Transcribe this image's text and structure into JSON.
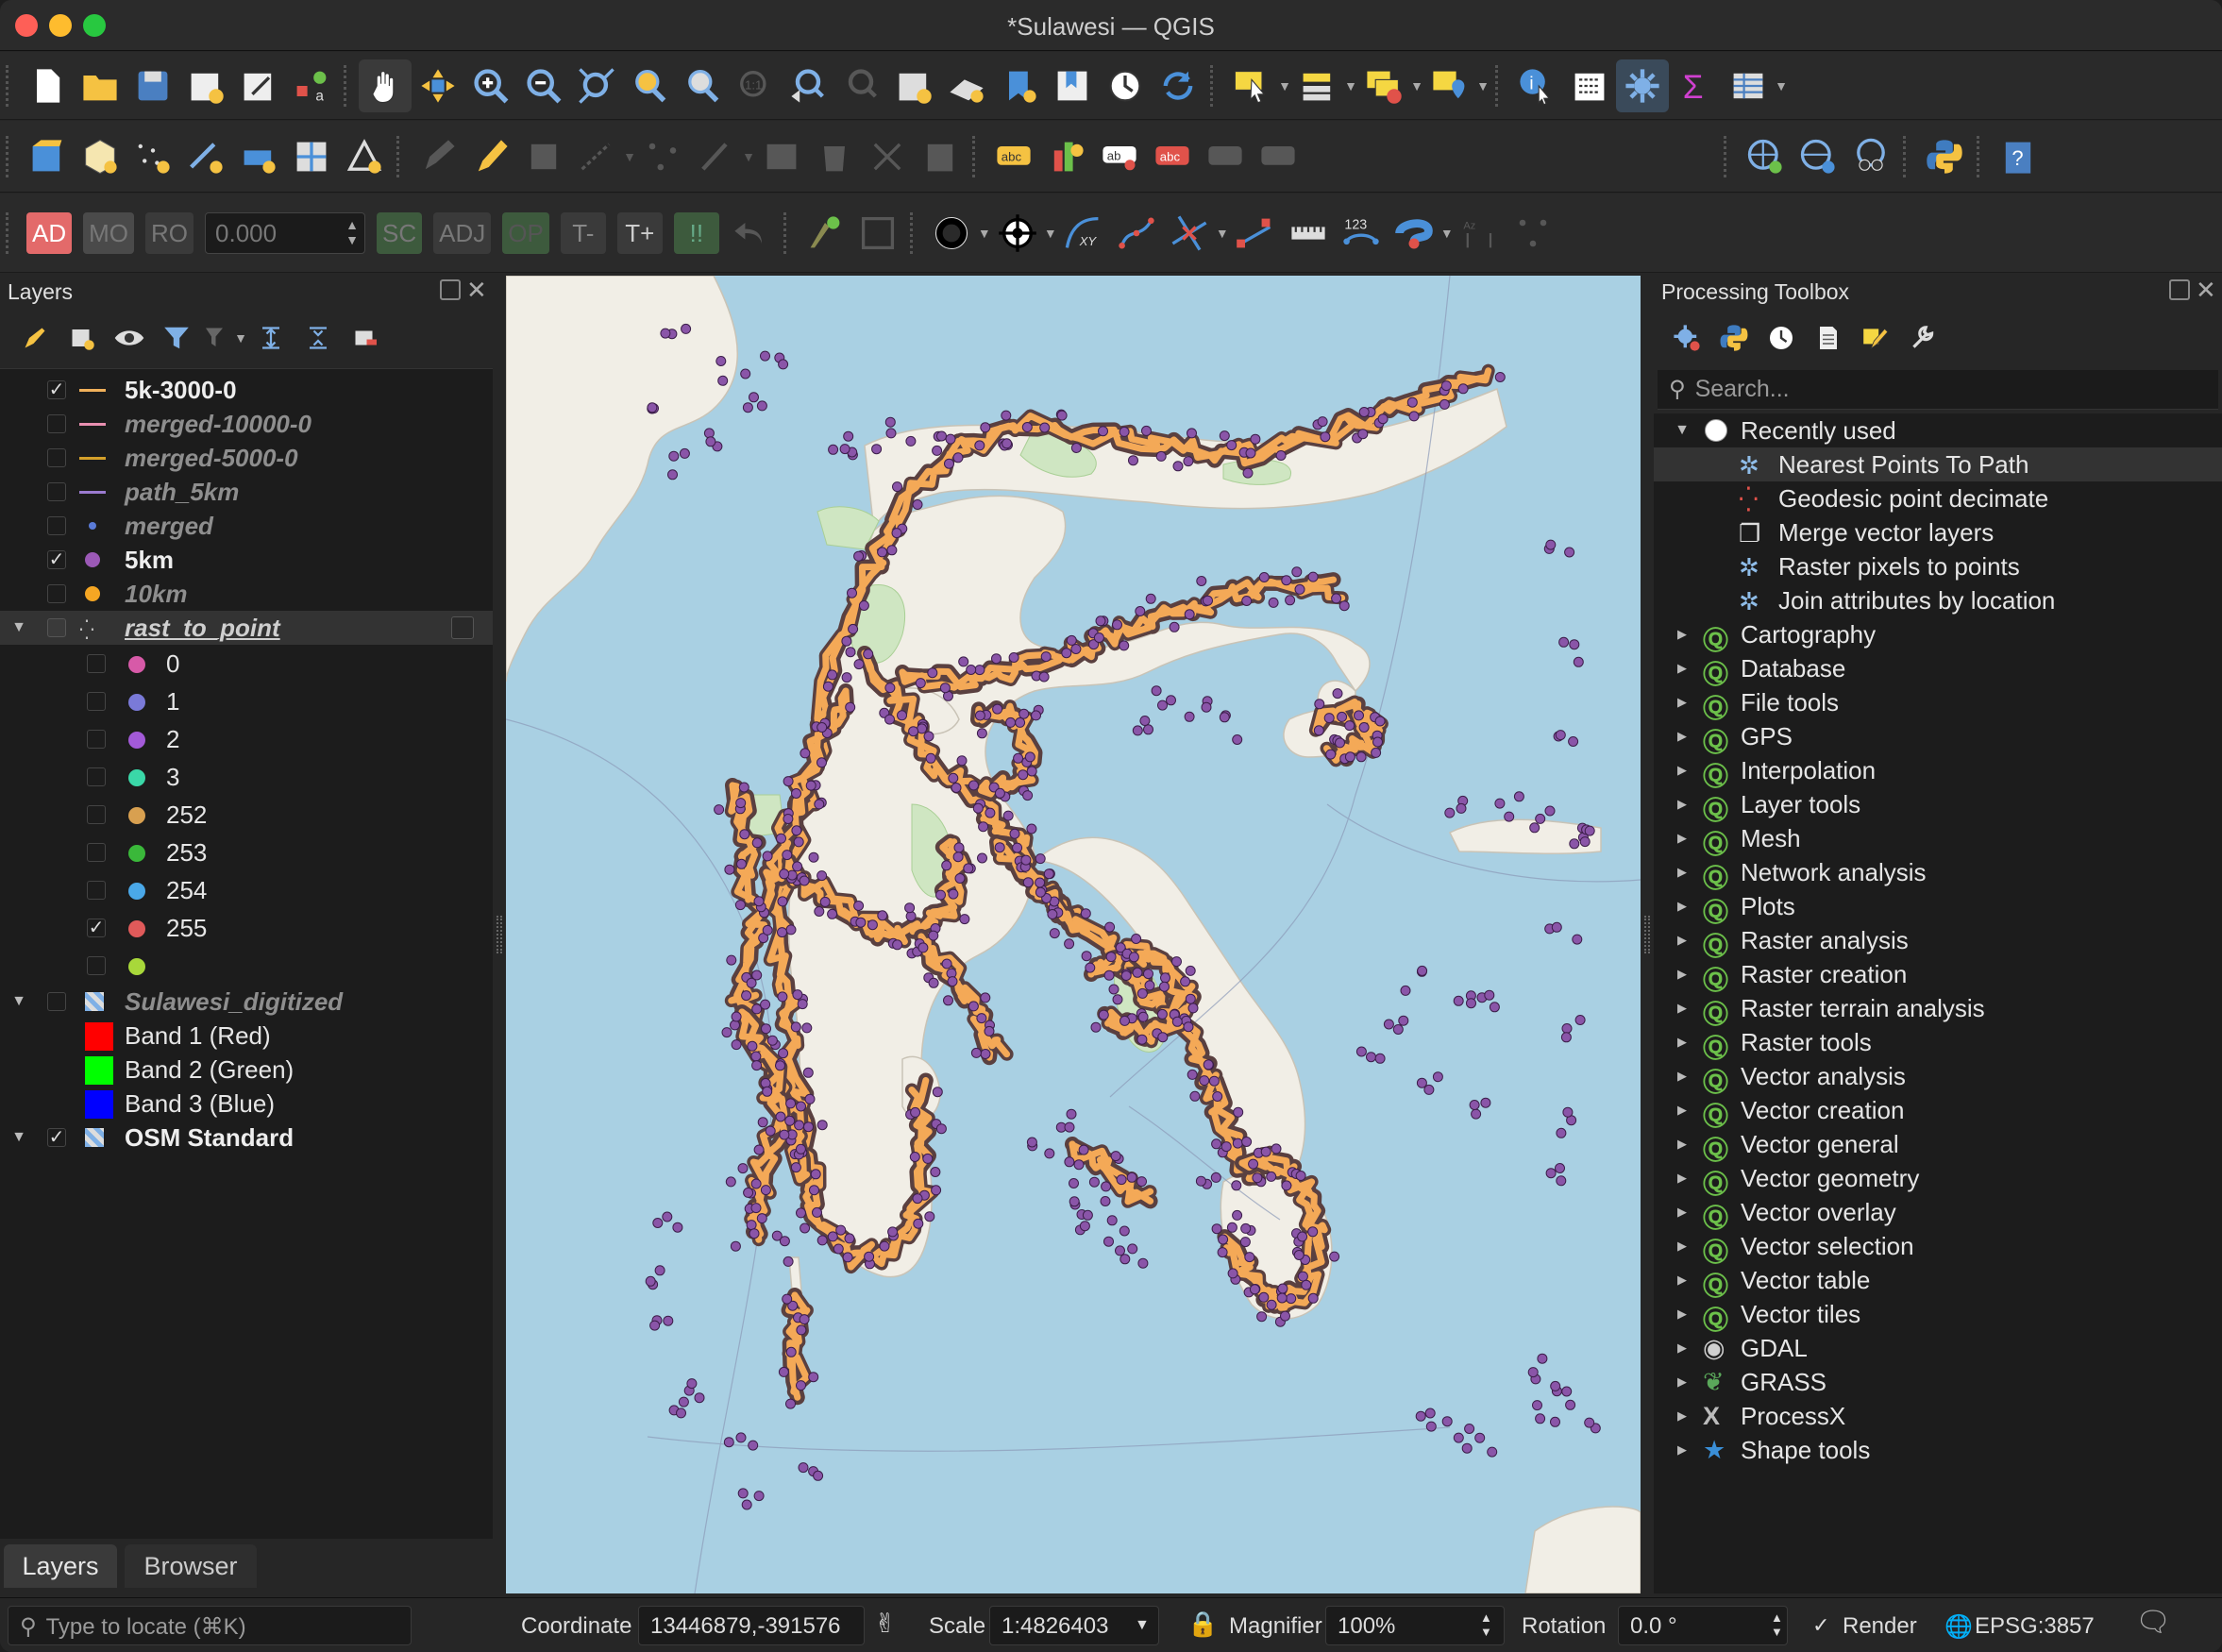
{
  "window": {
    "title": "*Sulawesi — QGIS"
  },
  "toolbar3": {
    "snap_value": "0.000",
    "ad": "AD",
    "mo": "MO",
    "ro": "RO",
    "sc": "SC",
    "adj": "ADJ",
    "op": "OP",
    "tminus": "T-",
    "tplus": "T+",
    "excl": "!!",
    "num123": "123"
  },
  "layers_panel": {
    "title": "Layers",
    "items": [
      {
        "label": "5k-3000-0",
        "checked": true,
        "symbol": "line",
        "color": "#f0b05a",
        "bold": true,
        "italic": false
      },
      {
        "label": "merged-10000-0",
        "checked": false,
        "symbol": "line",
        "color": "#e88fb0",
        "bold": true,
        "italic": true
      },
      {
        "label": "merged-5000-0",
        "checked": false,
        "symbol": "line",
        "color": "#d4a02a",
        "bold": true,
        "italic": true
      },
      {
        "label": "path_5km",
        "checked": false,
        "symbol": "line",
        "color": "#9b7bd0",
        "bold": true,
        "italic": true
      },
      {
        "label": "merged",
        "checked": false,
        "symbol": "dot-small",
        "color": "#5a7bd8",
        "bold": true,
        "italic": true
      },
      {
        "label": "5km",
        "checked": true,
        "symbol": "dot",
        "color": "#9b59b6",
        "bold": true,
        "italic": false
      },
      {
        "label": "10km",
        "checked": false,
        "symbol": "dot",
        "color": "#f5a623",
        "bold": true,
        "italic": true
      },
      {
        "label": "rast_to_point",
        "checked": false,
        "symbol": "points",
        "color": "#bbbbbb",
        "bold": true,
        "italic": true,
        "underline": true
      }
    ],
    "classes": [
      {
        "label": "0",
        "color": "#d75aa8",
        "checked": false
      },
      {
        "label": "1",
        "color": "#7a7ad8",
        "checked": false
      },
      {
        "label": "2",
        "color": "#a35ad8",
        "checked": false
      },
      {
        "label": "3",
        "color": "#3ad8a8",
        "checked": false
      },
      {
        "label": "252",
        "color": "#d8a050",
        "checked": false
      },
      {
        "label": "253",
        "color": "#3ab83a",
        "checked": false
      },
      {
        "label": "254",
        "color": "#4aa8e8",
        "checked": false
      },
      {
        "label": "255",
        "color": "#e05a5a",
        "checked": true
      },
      {
        "label": "",
        "color": "#a8d83a",
        "checked": false
      }
    ],
    "raster": {
      "label": "Sulawesi_digitized",
      "bands": [
        {
          "label": "Band 1 (Red)",
          "color": "#ff0000"
        },
        {
          "label": "Band 2 (Green)",
          "color": "#00ff00"
        },
        {
          "label": "Band 3 (Blue)",
          "color": "#0000ff"
        }
      ]
    },
    "basemap": {
      "label": "OSM Standard",
      "checked": true
    },
    "tabs": [
      "Layers",
      "Browser"
    ],
    "locator_placeholder": "Type to locate (⌘K)"
  },
  "toolbox": {
    "title": "Processing Toolbox",
    "search_placeholder": "Search...",
    "recent_label": "Recently used",
    "recent": [
      "Nearest Points To Path",
      "Geodesic point decimate",
      "Merge vector layers",
      "Raster pixels to points",
      "Join attributes by location"
    ],
    "groups": [
      "Cartography",
      "Database",
      "File tools",
      "GPS",
      "Interpolation",
      "Layer tools",
      "Mesh",
      "Network analysis",
      "Plots",
      "Raster analysis",
      "Raster creation",
      "Raster terrain analysis",
      "Raster tools",
      "Vector analysis",
      "Vector creation",
      "Vector general",
      "Vector geometry",
      "Vector overlay",
      "Vector selection",
      "Vector table",
      "Vector tiles",
      "GDAL",
      "GRASS",
      "ProcessX",
      "Shape tools"
    ]
  },
  "status": {
    "coordinate_label": "Coordinate",
    "coordinate": "13446879,-391576",
    "scale_label": "Scale",
    "scale": "1:4826403",
    "magnifier_label": "Magnifier",
    "magnifier": "100%",
    "rotation_label": "Rotation",
    "rotation": "0.0 °",
    "render_label": "Render",
    "crs": "EPSG:3857"
  },
  "map": {
    "sea_color": "#a9d0e3",
    "land_color": "#f0ede5",
    "route_color": "#f4a957",
    "point_color": "#8a55a8"
  }
}
